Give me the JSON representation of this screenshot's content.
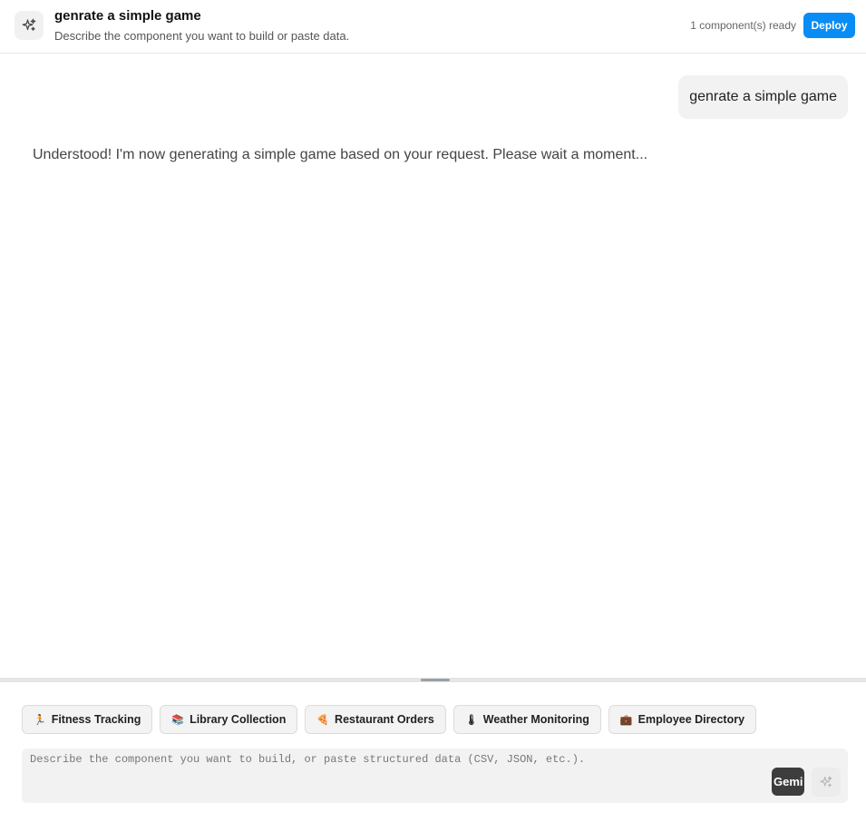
{
  "header": {
    "title": "genrate a simple game",
    "subtitle": "Describe the component you want to build or paste data.",
    "status": "1 component(s) ready",
    "deploy_label": "Deploy",
    "icon": "sparkles-icon"
  },
  "chat": {
    "user_message": "genrate a simple game",
    "assistant_message": "Understood! I'm now generating a simple game based on your request. Please wait a moment..."
  },
  "suggestions": [
    {
      "emoji": "🏃",
      "label": "Fitness Tracking"
    },
    {
      "emoji": "📚",
      "label": "Library Collection"
    },
    {
      "emoji": "🍕",
      "label": "Restaurant Orders"
    },
    {
      "emoji": "🌡",
      "label": "Weather Monitoring"
    },
    {
      "emoji": "💼",
      "label": "Employee Directory"
    }
  ],
  "prompt": {
    "placeholder": "Describe the component you want to build, or paste structured data (CSV, JSON, etc.).",
    "value": "",
    "model_label": "Gemi",
    "send_icon": "sparkles-icon"
  },
  "colors": {
    "accent": "#0a8cf5",
    "user_bubble": "#f2f2f2",
    "input_bg": "#f2f2f2"
  }
}
